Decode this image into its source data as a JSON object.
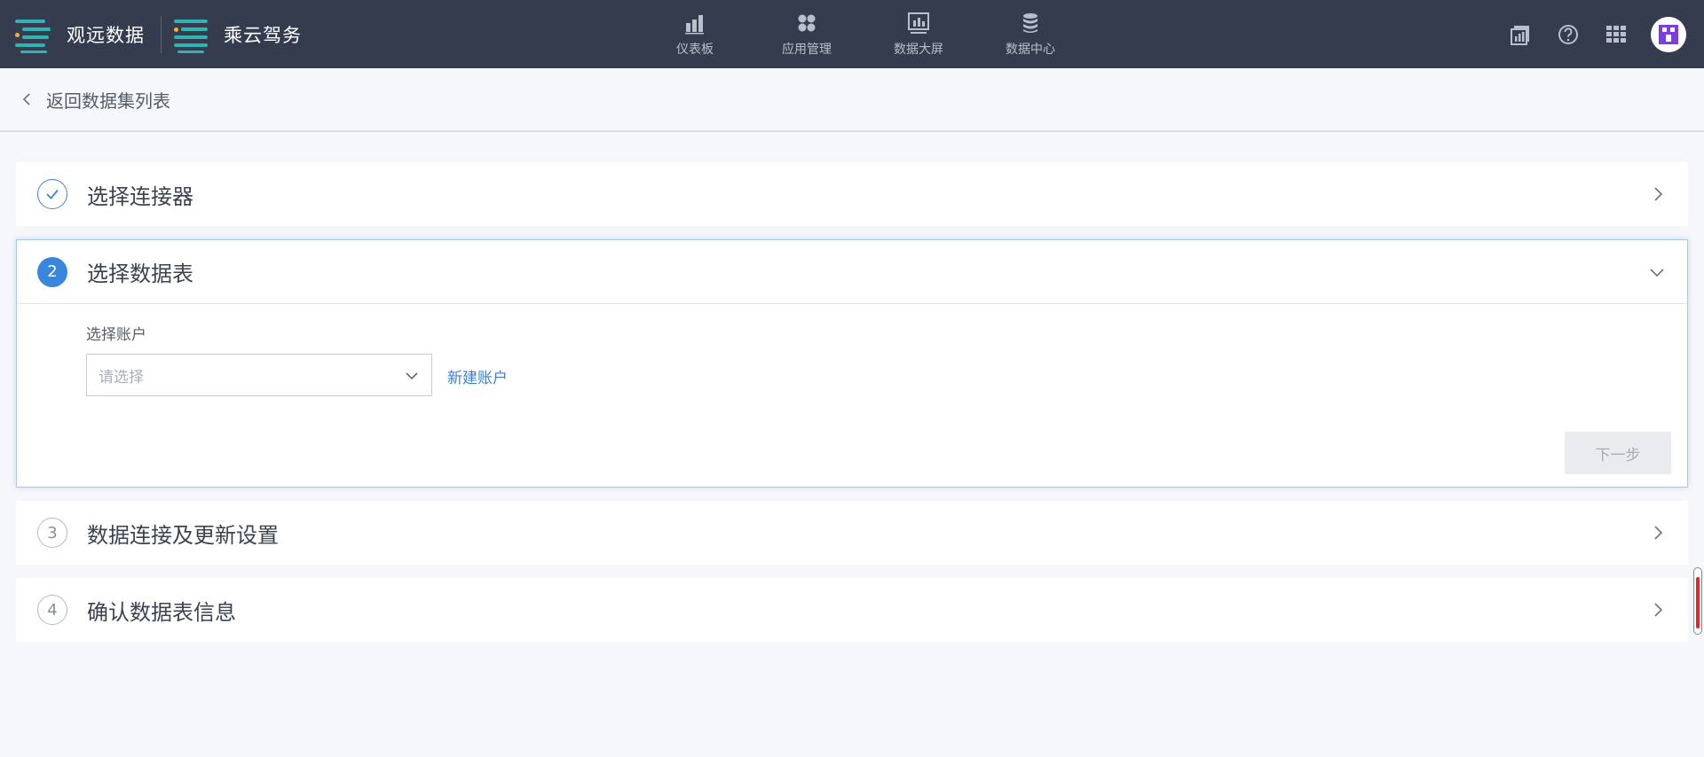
{
  "brand": {
    "primary_name": "观远数据",
    "secondary_name": "乘云驾务"
  },
  "nav": {
    "items": [
      {
        "label": "仪表板",
        "icon": "bar-chart-icon"
      },
      {
        "label": "应用管理",
        "icon": "apps-icon"
      },
      {
        "label": "数据大屏",
        "icon": "screen-chart-icon"
      },
      {
        "label": "数据中心",
        "icon": "database-icon"
      }
    ]
  },
  "toolbar": {
    "icons": [
      "report-icon",
      "help-icon",
      "grid-menu-icon"
    ],
    "avatar": "user-avatar"
  },
  "back": {
    "label": "返回数据集列表"
  },
  "steps": [
    {
      "number": "",
      "title": "选择连接器",
      "state": "done"
    },
    {
      "number": "2",
      "title": "选择数据表",
      "state": "active"
    },
    {
      "number": "3",
      "title": "数据连接及更新设置",
      "state": "pending"
    },
    {
      "number": "4",
      "title": "确认数据表信息",
      "state": "pending"
    }
  ],
  "account_form": {
    "label": "选择账户",
    "placeholder": "请选择",
    "new_account_link": "新建账户",
    "next_button": "下一步"
  },
  "colors": {
    "topbar": "#343c4e",
    "accent": "#3a7fd7",
    "step_active": "#3a86dc",
    "logo_teal": "#2fb4b3"
  }
}
